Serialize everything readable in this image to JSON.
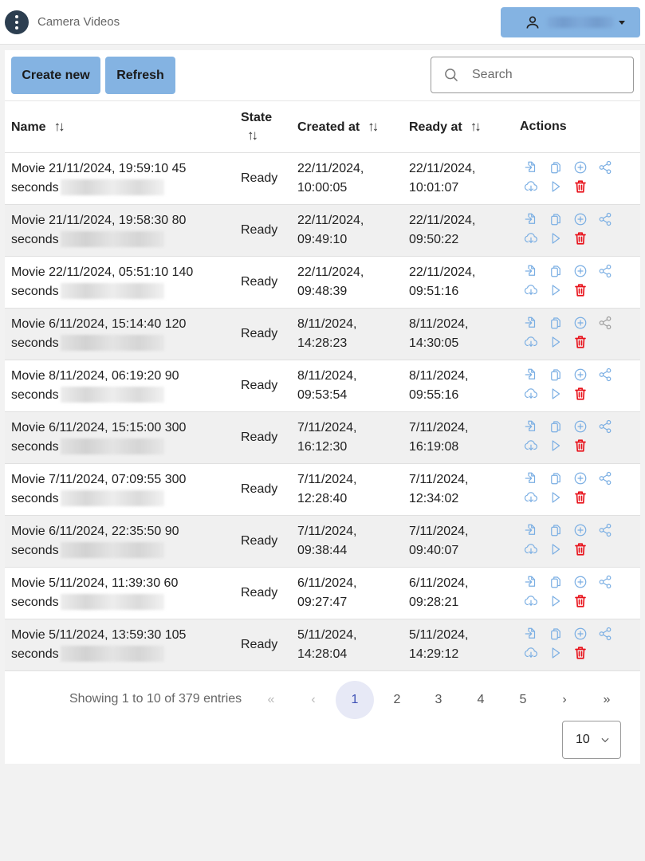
{
  "header": {
    "menu_icon": "vertical-dots-icon",
    "title": "Camera Videos",
    "user_icon": "user-icon",
    "user_name": "(redacted)"
  },
  "toolbar": {
    "create_label": "Create new",
    "refresh_label": "Refresh",
    "search_placeholder": "Search",
    "search_value": ""
  },
  "table": {
    "columns": [
      "Name",
      "State",
      "Created at",
      "Ready at",
      "Actions"
    ],
    "sortable": [
      true,
      true,
      true,
      true,
      false
    ],
    "rows": [
      {
        "name": "Movie 21/11/2024, 19:59:10 45 seconds",
        "state": "Ready",
        "created": "22/11/2024, 10:00:05",
        "ready": "22/11/2024, 10:01:07",
        "share_enabled": true
      },
      {
        "name": "Movie 21/11/2024, 19:58:30 80 seconds",
        "state": "Ready",
        "created": "22/11/2024, 09:49:10",
        "ready": "22/11/2024, 09:50:22",
        "share_enabled": true
      },
      {
        "name": "Movie 22/11/2024, 05:51:10 140 seconds",
        "state": "Ready",
        "created": "22/11/2024, 09:48:39",
        "ready": "22/11/2024, 09:51:16",
        "share_enabled": true
      },
      {
        "name": "Movie 6/11/2024, 15:14:40 120 seconds",
        "state": "Ready",
        "created": "8/11/2024, 14:28:23",
        "ready": "8/11/2024, 14:30:05",
        "share_enabled": false
      },
      {
        "name": "Movie 8/11/2024, 06:19:20 90 seconds",
        "state": "Ready",
        "created": "8/11/2024, 09:53:54",
        "ready": "8/11/2024, 09:55:16",
        "share_enabled": true
      },
      {
        "name": "Movie 6/11/2024, 15:15:00 300 seconds",
        "state": "Ready",
        "created": "7/11/2024, 16:12:30",
        "ready": "7/11/2024, 16:19:08",
        "share_enabled": true
      },
      {
        "name": "Movie 7/11/2024, 07:09:55 300 seconds",
        "state": "Ready",
        "created": "7/11/2024, 12:28:40",
        "ready": "7/11/2024, 12:34:02",
        "share_enabled": true
      },
      {
        "name": "Movie 6/11/2024, 22:35:50 90 seconds",
        "state": "Ready",
        "created": "7/11/2024, 09:38:44",
        "ready": "7/11/2024, 09:40:07",
        "share_enabled": true
      },
      {
        "name": "Movie 5/11/2024, 11:39:30 60 seconds",
        "state": "Ready",
        "created": "6/11/2024, 09:27:47",
        "ready": "6/11/2024, 09:28:21",
        "share_enabled": true
      },
      {
        "name": "Movie 5/11/2024, 13:59:30 105 seconds",
        "state": "Ready",
        "created": "5/11/2024, 14:28:04",
        "ready": "5/11/2024, 14:29:12",
        "share_enabled": true
      }
    ],
    "action_icons": [
      "import-icon",
      "copy-icon",
      "add-circle-icon",
      "share-icon",
      "cloud-download-icon",
      "play-icon",
      "delete-icon"
    ]
  },
  "pagination": {
    "showing_text": "Showing 1 to 10 of 379 entries",
    "first": "«",
    "prev": "‹",
    "pages": [
      "1",
      "2",
      "3",
      "4",
      "5"
    ],
    "current_page": "1",
    "next": "›",
    "last": "»",
    "per_page": "10"
  },
  "colors": {
    "accent": "#84b3e2",
    "icon_blue": "#7aaee3",
    "delete_red": "#e8121b",
    "disabled_grey": "#9e9e9e",
    "active_page_bg": "#e7e9f6",
    "active_page_text": "#3f51b5"
  }
}
